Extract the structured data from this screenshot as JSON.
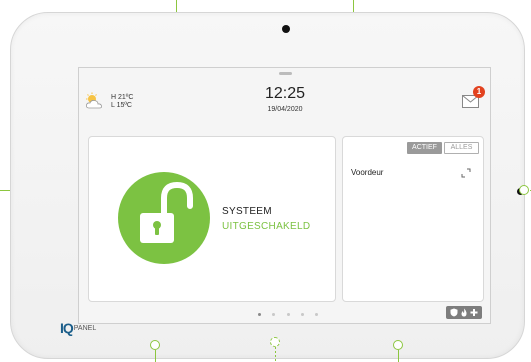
{
  "weather": {
    "icon": "partly-cloudy-icon",
    "high": "H 21ºC",
    "low": "L 15ºC"
  },
  "clock": {
    "time": "12:25",
    "date": "19/04/2020"
  },
  "messages": {
    "icon": "mail-icon",
    "unread_count": "1"
  },
  "system_status": {
    "line1": "SYSTEEM",
    "line2": "UITGESCHAKELD",
    "icon": "unlocked-padlock-icon",
    "color": "#7cc242"
  },
  "sensors": {
    "filter_active": "ACTIEF",
    "filter_all": "ALLES",
    "items": [
      {
        "name": "Voordeur",
        "icon": "door-open-icon"
      }
    ]
  },
  "pagination": {
    "pages": 5,
    "current": 1
  },
  "emergency": {
    "icons": [
      "police-shield-icon",
      "fire-icon",
      "medical-cross-icon"
    ]
  },
  "brand": {
    "mark": "IQ",
    "text": "PANEL",
    "color": "#1b5e8a"
  },
  "colors": {
    "callout": "#8cc63f",
    "badge": "#e2421f"
  }
}
